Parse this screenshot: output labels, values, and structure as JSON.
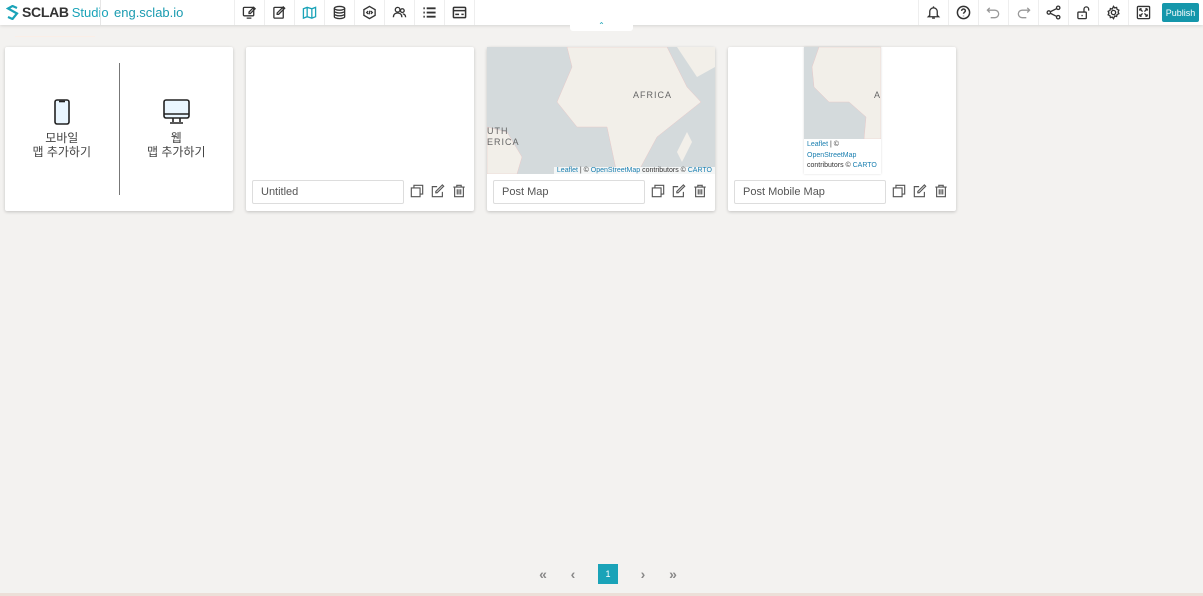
{
  "header": {
    "logo_main": "SCLAB",
    "logo_sub": "Studio",
    "domain": "eng.sclab.io",
    "publish_label": "Publish",
    "left_tools": [
      "edit-screen-icon",
      "edit-icon",
      "map-icon",
      "database-icon",
      "code-icon",
      "users-icon",
      "list-icon",
      "card-icon"
    ],
    "right_tools": [
      "bell-icon",
      "help-icon",
      "undo-icon",
      "redo-icon",
      "share-icon",
      "unlock-icon",
      "gear-icon",
      "fullscreen-icon"
    ]
  },
  "add_card": {
    "mobile_line1": "모바일",
    "mobile_line2": "맵 추가하기",
    "web_line1": "웹",
    "web_line2": "맵 추가하기"
  },
  "maps": [
    {
      "name": "Untitled",
      "has_map": false
    },
    {
      "name": "Post Map",
      "has_map": true,
      "labels": [
        "AFRICA",
        "UTH",
        "ERICA"
      ],
      "attr_leaflet": "Leaflet",
      "attr_sep": " | © ",
      "attr_osm": "OpenStreetMap",
      "attr_contrib": " contributors © ",
      "attr_carto": "CARTO"
    },
    {
      "name": "Post Mobile Map",
      "has_map": true,
      "labels": [
        "A"
      ],
      "attr_leaflet": "Leaflet",
      "attr_sep": " | © ",
      "attr_osm": "OpenStreetMap",
      "attr_contrib": "contributors © ",
      "attr_carto": "CARTO"
    }
  ],
  "pagination": {
    "first": "«",
    "prev": "‹",
    "current": "1",
    "next": "›",
    "last": "»"
  },
  "colors": {
    "accent": "#1aa3b8",
    "publish": "#1597ab",
    "background": "#f3f2f0"
  }
}
